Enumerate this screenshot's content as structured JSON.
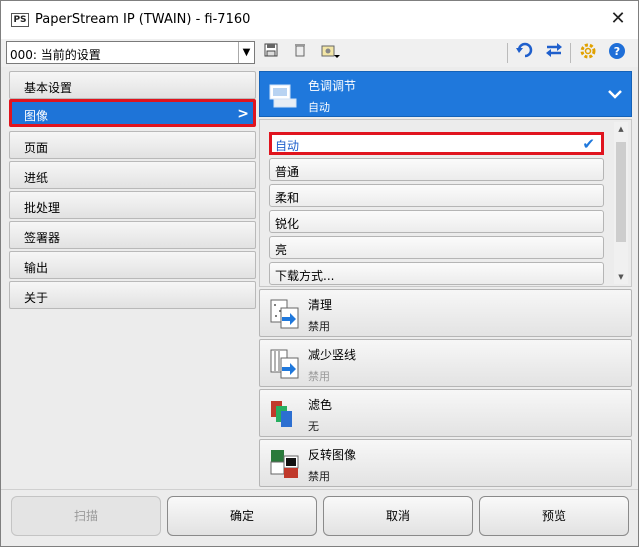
{
  "window": {
    "app_badge": "PS",
    "title": "PaperStream IP (TWAIN) - fi-7160",
    "close": "✕"
  },
  "toolbar": {
    "profile_value": "000: 当前的设置"
  },
  "nav": {
    "items": [
      {
        "label": "基本设置"
      },
      {
        "label": "图像"
      },
      {
        "label": "页面"
      },
      {
        "label": "进纸"
      },
      {
        "label": "批处理"
      },
      {
        "label": "签署器"
      },
      {
        "label": "输出"
      },
      {
        "label": "关于"
      }
    ],
    "active_index": 1
  },
  "color_tone": {
    "title": "色调调节",
    "value": "自动",
    "options": [
      {
        "label": "自动"
      },
      {
        "label": "普通"
      },
      {
        "label": "柔和"
      },
      {
        "label": "锐化"
      },
      {
        "label": "亮"
      },
      {
        "label": "下载方式..."
      }
    ]
  },
  "features": [
    {
      "title": "清理",
      "value": "禁用"
    },
    {
      "title": "减少竖线",
      "value": "禁用"
    },
    {
      "title": "滤色",
      "value": "无"
    },
    {
      "title": "反转图像",
      "value": "禁用"
    }
  ],
  "buttons": {
    "scan": "扫描",
    "ok": "确定",
    "cancel": "取消",
    "preview": "预览"
  },
  "colors": {
    "accent": "#1f78dc",
    "highlight_border": "#e0141e"
  }
}
